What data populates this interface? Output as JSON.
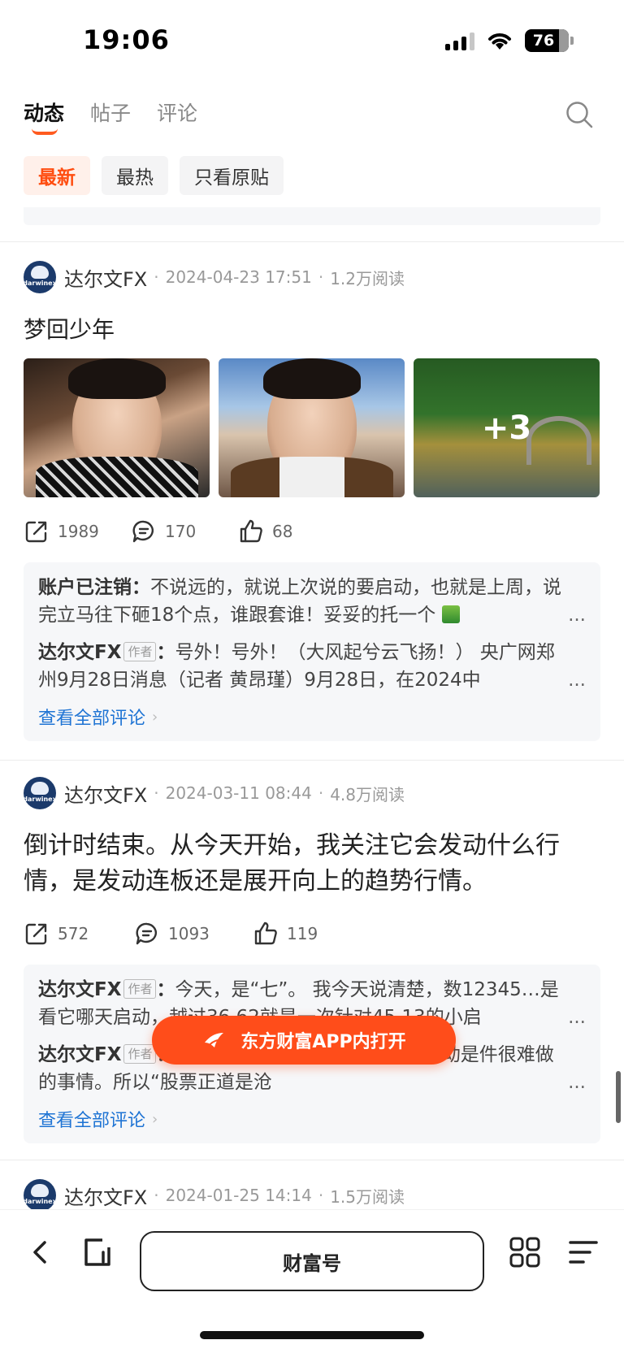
{
  "status_bar": {
    "time": "19:06",
    "battery": "76"
  },
  "top_tabs": [
    {
      "label": "动态",
      "active": true
    },
    {
      "label": "帖子",
      "active": false
    },
    {
      "label": "评论",
      "active": false
    }
  ],
  "filters": [
    {
      "label": "最新",
      "active": true
    },
    {
      "label": "最热",
      "active": false
    },
    {
      "label": "只看原贴",
      "active": false
    }
  ],
  "posts": [
    {
      "author": "达尔文FX",
      "avatar_text": "darwinex",
      "date": "2024-04-23 17:51",
      "reads": "1.2万阅读",
      "title": "梦回少年",
      "more_images": "+3",
      "shares": "1989",
      "comments_count": "170",
      "likes": "68",
      "comments": [
        {
          "name": "账户已注销",
          "author_tag": "",
          "text": "不说远的，就说上次说的要启动，也就是上周，说完立马往下砸18个点，谁跟套谁！妥妥的托一个"
        },
        {
          "name": "达尔文FX",
          "author_tag": "作者",
          "text": "号外！号外！（大风起兮云飞扬！） 央广网郑州9月28日消息（记者 黄昂瑾）9月28日，在2024中"
        }
      ],
      "see_all": "查看全部评论"
    },
    {
      "author": "达尔文FX",
      "avatar_text": "darwinex",
      "date": "2024-03-11 08:44",
      "reads": "4.8万阅读",
      "title": "倒计时结束。从今天开始，我关注它会发动什么行情，是发动连板还是展开向上的趋势行情。",
      "shares": "572",
      "comments_count": "1093",
      "likes": "119",
      "comments": [
        {
          "name": "达尔文FX",
          "author_tag": "作者",
          "text": "今天，是“七”。 我今天说清楚，数12345…是看它哪天启动，越过36.62就是一次针对45.13的小启"
        },
        {
          "name": "达尔文FX",
          "author_tag": "作者",
          "text": "……突破45，确证了判断短期波动是件很难做的事情。所以“股票正道是沧"
        }
      ],
      "see_all": "查看全部评论"
    },
    {
      "author": "达尔文FX",
      "avatar_text": "darwinex",
      "date": "2024-01-25 14:14",
      "reads": "1.5万阅读"
    }
  ],
  "float_button": {
    "label": "东方财富APP内打开"
  },
  "bottom_bar": {
    "url_label": "财富号"
  },
  "ellipsis": "...",
  "chevron": "›",
  "colors": {
    "accent": "#ff4d1a",
    "link": "#1f74d4",
    "active_chip_bg": "#fff0ea"
  }
}
